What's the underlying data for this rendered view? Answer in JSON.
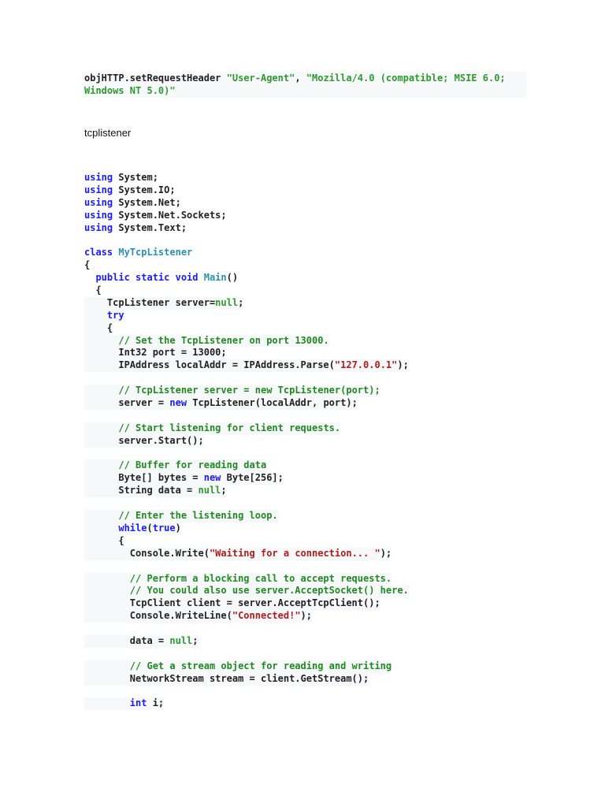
{
  "header_code": {
    "object": "objHTTP",
    "method": ".setRequestHeader ",
    "arg1": "\"User-Agent\"",
    "sep": ", ",
    "arg2_line1": "\"Mozilla/4.0 (compatible; MSIE 6.0;",
    "arg2_line2": "Windows NT 5.0)\""
  },
  "section_title": "tcplistener",
  "code_lines": [
    {
      "bg": false,
      "tokens": [
        [
          "using",
          "kw"
        ],
        [
          " System;",
          ""
        ]
      ]
    },
    {
      "bg": false,
      "tokens": [
        [
          "using",
          "kw"
        ],
        [
          " System.IO;",
          ""
        ]
      ]
    },
    {
      "bg": false,
      "tokens": [
        [
          "using",
          "kw"
        ],
        [
          " System.Net;",
          ""
        ]
      ]
    },
    {
      "bg": false,
      "tokens": [
        [
          "using",
          "kw"
        ],
        [
          " System.Net.Sockets;",
          ""
        ]
      ]
    },
    {
      "bg": false,
      "tokens": [
        [
          "using",
          "kw"
        ],
        [
          " System.Text;",
          ""
        ]
      ]
    },
    {
      "bg": false,
      "tokens": []
    },
    {
      "bg": false,
      "tokens": [
        [
          "class",
          "kw"
        ],
        [
          " ",
          ""
        ],
        [
          "MyTcpListener",
          "ty"
        ]
      ]
    },
    {
      "bg": false,
      "tokens": [
        [
          "{",
          ""
        ]
      ]
    },
    {
      "bg": false,
      "tokens": [
        [
          "  ",
          ""
        ],
        [
          "public static void",
          "kw"
        ],
        [
          " ",
          ""
        ],
        [
          "Main",
          "ty"
        ],
        [
          "()",
          ""
        ]
      ]
    },
    {
      "bg": false,
      "tokens": [
        [
          "  {",
          ""
        ]
      ]
    },
    {
      "bg": true,
      "tokens": [
        [
          "    TcpListener server=",
          ""
        ],
        [
          "null",
          "gr"
        ],
        [
          ";",
          ""
        ]
      ]
    },
    {
      "bg": true,
      "tokens": [
        [
          "    ",
          ""
        ],
        [
          "try",
          "kw"
        ]
      ]
    },
    {
      "bg": true,
      "tokens": [
        [
          "    {",
          ""
        ]
      ]
    },
    {
      "bg": true,
      "tokens": [
        [
          "      ",
          ""
        ],
        [
          "// Set the TcpListener on port 13000.",
          "cm"
        ]
      ]
    },
    {
      "bg": true,
      "tokens": [
        [
          "      Int32 port = 13000;",
          ""
        ]
      ]
    },
    {
      "bg": true,
      "tokens": [
        [
          "      IPAddress localAddr = IPAddress.Parse(",
          ""
        ],
        [
          "\"127.0.0.1\"",
          "st"
        ],
        [
          ");",
          ""
        ]
      ]
    },
    {
      "bg": false,
      "tokens": []
    },
    {
      "bg": true,
      "tokens": [
        [
          "      ",
          ""
        ],
        [
          "// TcpListener server = new TcpListener(port);",
          "cm"
        ]
      ]
    },
    {
      "bg": true,
      "tokens": [
        [
          "      server = ",
          ""
        ],
        [
          "new",
          "kw"
        ],
        [
          " TcpListener(localAddr, port);",
          ""
        ]
      ]
    },
    {
      "bg": false,
      "tokens": []
    },
    {
      "bg": true,
      "tokens": [
        [
          "      ",
          ""
        ],
        [
          "// Start listening for client requests.",
          "cm"
        ]
      ]
    },
    {
      "bg": true,
      "tokens": [
        [
          "      server.Start();",
          ""
        ]
      ]
    },
    {
      "bg": false,
      "tokens": []
    },
    {
      "bg": true,
      "tokens": [
        [
          "      ",
          ""
        ],
        [
          "// Buffer for reading data",
          "cm"
        ]
      ]
    },
    {
      "bg": true,
      "tokens": [
        [
          "      Byte[] bytes = ",
          ""
        ],
        [
          "new",
          "kw"
        ],
        [
          " Byte[256];",
          ""
        ]
      ]
    },
    {
      "bg": true,
      "tokens": [
        [
          "      String data = ",
          ""
        ],
        [
          "null",
          "gr"
        ],
        [
          ";",
          ""
        ]
      ]
    },
    {
      "bg": false,
      "tokens": []
    },
    {
      "bg": true,
      "tokens": [
        [
          "      ",
          ""
        ],
        [
          "// Enter the listening loop.",
          "cm"
        ]
      ]
    },
    {
      "bg": true,
      "tokens": [
        [
          "      ",
          ""
        ],
        [
          "while",
          "kw"
        ],
        [
          "(",
          ""
        ],
        [
          "true",
          "kw"
        ],
        [
          ")",
          ""
        ]
      ]
    },
    {
      "bg": true,
      "tokens": [
        [
          "      {",
          ""
        ]
      ]
    },
    {
      "bg": true,
      "tokens": [
        [
          "        Console.Write(",
          ""
        ],
        [
          "\"Waiting for a connection... \"",
          "st"
        ],
        [
          ");",
          ""
        ]
      ]
    },
    {
      "bg": false,
      "tokens": []
    },
    {
      "bg": true,
      "tokens": [
        [
          "        ",
          ""
        ],
        [
          "// Perform a blocking call to accept requests.",
          "cm"
        ]
      ]
    },
    {
      "bg": true,
      "tokens": [
        [
          "        ",
          ""
        ],
        [
          "// You could also use server.AcceptSocket() here.",
          "cm"
        ]
      ]
    },
    {
      "bg": true,
      "tokens": [
        [
          "        TcpClient client = server.AcceptTcpClient();",
          ""
        ]
      ]
    },
    {
      "bg": true,
      "tokens": [
        [
          "        Console.WriteLine(",
          ""
        ],
        [
          "\"Connected!\"",
          "st"
        ],
        [
          ");",
          ""
        ]
      ]
    },
    {
      "bg": false,
      "tokens": []
    },
    {
      "bg": true,
      "tokens": [
        [
          "        data = ",
          ""
        ],
        [
          "null",
          "gr"
        ],
        [
          ";",
          ""
        ]
      ]
    },
    {
      "bg": false,
      "tokens": []
    },
    {
      "bg": true,
      "tokens": [
        [
          "        ",
          ""
        ],
        [
          "// Get a stream object for reading and writing",
          "cm"
        ]
      ]
    },
    {
      "bg": true,
      "tokens": [
        [
          "        NetworkStream stream = client.GetStream();",
          ""
        ]
      ]
    },
    {
      "bg": false,
      "tokens": []
    },
    {
      "bg": true,
      "tokens": [
        [
          "        ",
          ""
        ],
        [
          "int",
          "kw"
        ],
        [
          " i;",
          ""
        ]
      ]
    }
  ]
}
